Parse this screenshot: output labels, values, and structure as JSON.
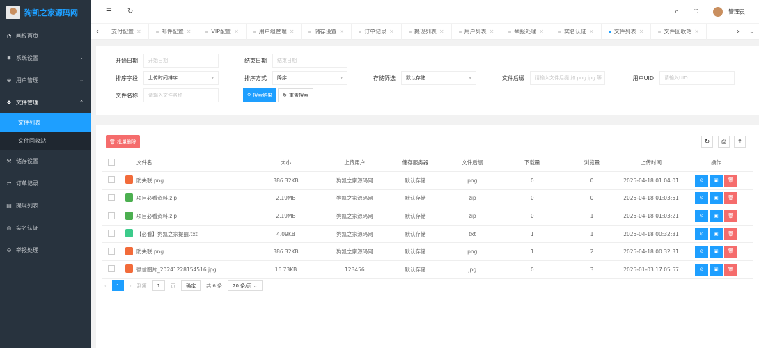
{
  "app": {
    "title": "狗凯之家源码网",
    "user": "管理员"
  },
  "sidebar": {
    "items": [
      {
        "label": "画板首页",
        "icon": "◔"
      },
      {
        "label": "系统设置",
        "icon": "✹",
        "arrow": "⌄"
      },
      {
        "label": "用户管理",
        "icon": "⊕",
        "arrow": "⌄"
      },
      {
        "label": "文件管理",
        "icon": "❖",
        "arrow": "⌃"
      },
      {
        "label": "文件列表"
      },
      {
        "label": "文件回收站"
      },
      {
        "label": "储存设置",
        "icon": "⚒"
      },
      {
        "label": "订单记录",
        "icon": "⇄"
      },
      {
        "label": "提现列表",
        "icon": "▤"
      },
      {
        "label": "实名认证",
        "icon": "◎"
      },
      {
        "label": "举报处理",
        "icon": "⊙"
      }
    ]
  },
  "tabs": [
    "支付配置",
    "邮件配置",
    "VIP配置",
    "用户组管理",
    "储存设置",
    "订单记录",
    "提现列表",
    "用户列表",
    "举报处理",
    "实名认证",
    "文件列表",
    "文件回收站"
  ],
  "filters": {
    "start_date": {
      "label": "开始日期",
      "placeholder": "开始日期"
    },
    "end_date": {
      "label": "结束日期",
      "placeholder": "结束日期"
    },
    "sort_field": {
      "label": "排序字段",
      "value": "上传时间排序"
    },
    "sort_order": {
      "label": "排序方式",
      "value": "降序"
    },
    "storage": {
      "label": "存储筛选",
      "value": "默认存储"
    },
    "suffix": {
      "label": "文件后缀",
      "placeholder": "请输入文件后缀 如 png jpg 等"
    },
    "uid": {
      "label": "用户UID",
      "placeholder": "请输入UID"
    },
    "name": {
      "label": "文件名称",
      "placeholder": "请输入文件名称"
    },
    "search": "搜索结果",
    "reset": "重置搜索"
  },
  "batch_delete": "批量删除",
  "table": {
    "headers": [
      "文件名",
      "大小",
      "上传用户",
      "储存服务器",
      "文件后缀",
      "下载量",
      "浏览量",
      "上传时间",
      "操作"
    ],
    "rows": [
      {
        "icon": "#f26b3a",
        "name": "防失联.png",
        "size": "386.32KB",
        "user": "狗凯之家源码网",
        "storage": "默认存储",
        "ext": "png",
        "downloads": "0",
        "views": "0",
        "time": "2025-04-18 01:04:01"
      },
      {
        "icon": "#4caf50",
        "name": "项目必看资料.zip",
        "size": "2.19MB",
        "user": "狗凯之家源码网",
        "storage": "默认存储",
        "ext": "zip",
        "downloads": "0",
        "views": "0",
        "time": "2025-04-18 01:03:51"
      },
      {
        "icon": "#4caf50",
        "name": "项目必看资料.zip",
        "size": "2.19MB",
        "user": "狗凯之家源码网",
        "storage": "默认存储",
        "ext": "zip",
        "downloads": "0",
        "views": "1",
        "time": "2025-04-18 01:03:21"
      },
      {
        "icon": "#3ccb8b",
        "name": "【必看】狗凯之家提醒.txt",
        "size": "4.09KB",
        "user": "狗凯之家源码网",
        "storage": "默认存储",
        "ext": "txt",
        "downloads": "1",
        "views": "1",
        "time": "2025-04-18 00:32:31"
      },
      {
        "icon": "#f26b3a",
        "name": "防失联.png",
        "size": "386.32KB",
        "user": "狗凯之家源码网",
        "storage": "默认存储",
        "ext": "png",
        "downloads": "1",
        "views": "2",
        "time": "2025-04-18 00:32:31"
      },
      {
        "icon": "#f26b3a",
        "name": "微信图片_20241228154516.jpg",
        "size": "16.73KB",
        "user": "123456",
        "storage": "默认存储",
        "ext": "jpg",
        "downloads": "0",
        "views": "3",
        "time": "2025-01-03 17:05:57"
      }
    ]
  },
  "pagination": {
    "current": "1",
    "goto_label": "到第",
    "goto_value": "1",
    "page_unit": "页",
    "confirm": "确定",
    "total": "共 6 条",
    "per_page": "20 条/页"
  }
}
